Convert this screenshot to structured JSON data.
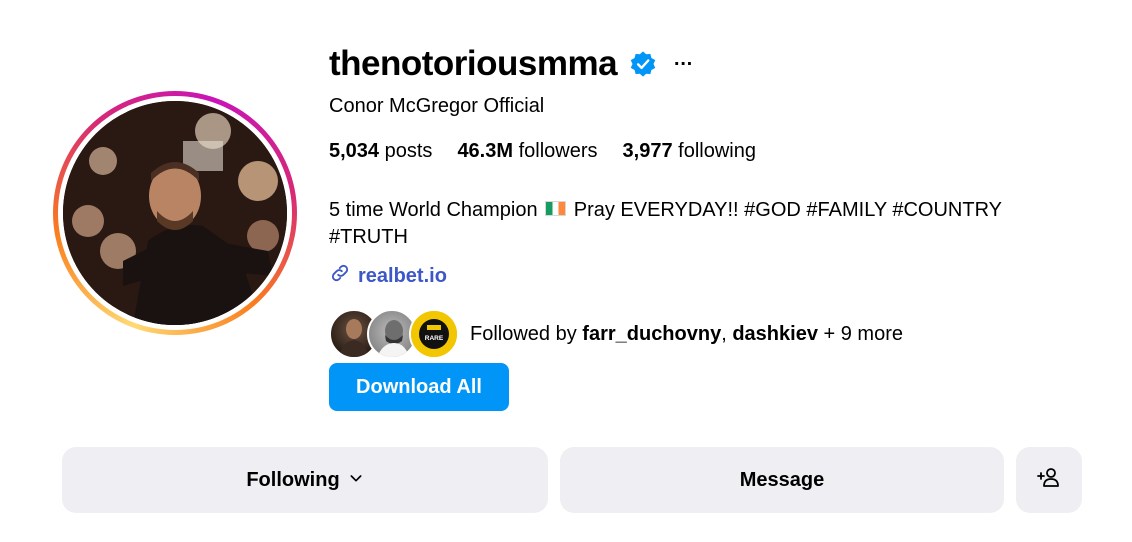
{
  "profile": {
    "username": "thenotoriousmma",
    "full_name": "Conor McGregor Official",
    "verified": true,
    "more_icon": "…"
  },
  "stats": {
    "posts_count": "5,034",
    "posts_label": "posts",
    "followers_count": "46.3M",
    "followers_label": "followers",
    "following_count": "3,977",
    "following_label": "following"
  },
  "bio": {
    "text_before_flag": "5 time World Champion",
    "flag_icon": "ireland-flag-icon",
    "text_after_flag": "Pray EVERYDAY!! #GOD #FAMILY #COUNTRY #TRUTH"
  },
  "link": {
    "icon": "link-icon",
    "text": "realbet.io"
  },
  "followed_by": {
    "prefix": "Followed by",
    "user1": "farr_duchovny",
    "separator": ",",
    "user2": "dashkiev",
    "suffix": "+ 9 more",
    "mini_avatar3_text": "RARE"
  },
  "download": {
    "label": "Download All"
  },
  "actions": {
    "following_label": "Following",
    "message_label": "Message"
  },
  "colors": {
    "accent_blue": "#0095f6",
    "link_blue": "#3d57c9",
    "verified_blue": "#0095f6",
    "button_gray": "#efeff3"
  }
}
